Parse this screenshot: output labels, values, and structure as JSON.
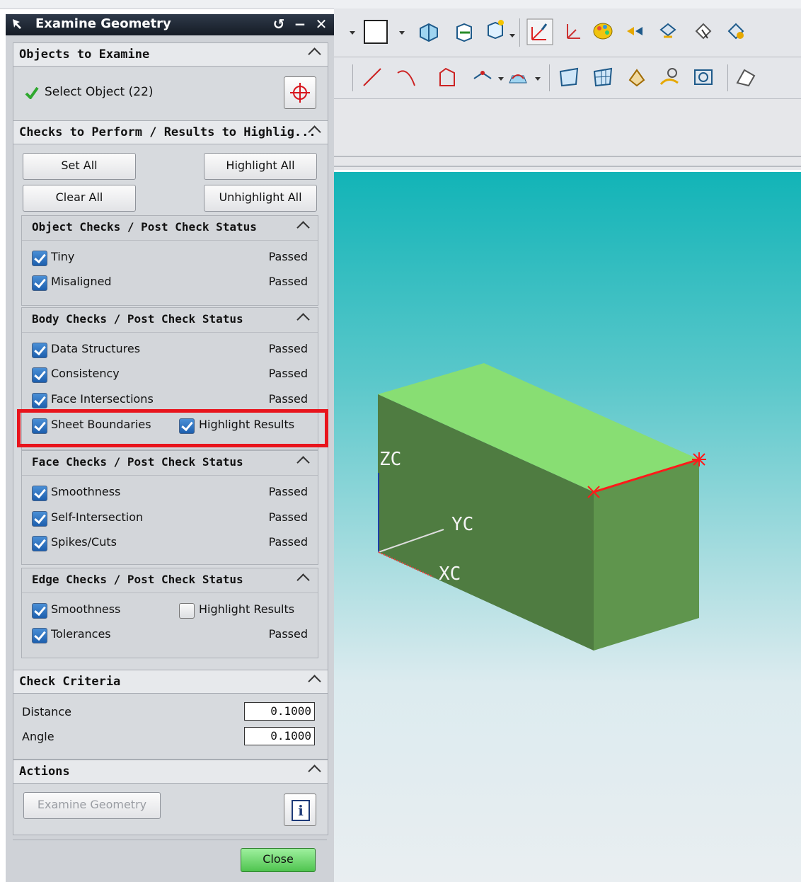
{
  "dialog": {
    "title": "Examine Geometry",
    "title_buttons": [
      "reset-icon",
      "minimize-icon",
      "close-icon"
    ]
  },
  "objects_to_examine": {
    "header": "Objects to Examine",
    "select_label": "Select Object (22)"
  },
  "checks": {
    "header": "Checks to Perform / Results to Highlig...",
    "buttons": {
      "set_all": "Set All",
      "highlight_all": "Highlight All",
      "clear_all": "Clear All",
      "unhighlight_all": "Unhighlight All"
    },
    "object_checks": {
      "header": "Object Checks / Post Check Status",
      "rows": [
        {
          "label": "Tiny",
          "checked": true,
          "status": "Passed"
        },
        {
          "label": "Misaligned",
          "checked": true,
          "status": "Passed"
        }
      ]
    },
    "body_checks": {
      "header": "Body Checks / Post Check Status",
      "rows": [
        {
          "label": "Data Structures",
          "checked": true,
          "status": "Passed"
        },
        {
          "label": "Consistency",
          "checked": true,
          "status": "Passed"
        },
        {
          "label": "Face Intersections",
          "checked": true,
          "status": "Passed"
        },
        {
          "label": "Sheet Boundaries",
          "checked": true,
          "highlight_label": "Highlight Results",
          "highlight_checked": true
        }
      ]
    },
    "face_checks": {
      "header": "Face Checks / Post Check Status",
      "rows": [
        {
          "label": "Smoothness",
          "checked": true,
          "status": "Passed"
        },
        {
          "label": "Self-Intersection",
          "checked": true,
          "status": "Passed"
        },
        {
          "label": "Spikes/Cuts",
          "checked": true,
          "status": "Passed"
        }
      ]
    },
    "edge_checks": {
      "header": "Edge Checks / Post Check Status",
      "rows": [
        {
          "label": "Smoothness",
          "checked": true,
          "highlight_label": "Highlight Results",
          "highlight_checked": false
        },
        {
          "label": "Tolerances",
          "checked": true,
          "status": "Passed"
        }
      ]
    }
  },
  "check_criteria": {
    "header": "Check Criteria",
    "distance_label": "Distance",
    "distance_value": "0.1000",
    "angle_label": "Angle",
    "angle_value": "0.1000"
  },
  "actions": {
    "header": "Actions",
    "examine_button": "Examine Geometry",
    "info_icon": "i"
  },
  "close_button": "Close",
  "viewport": {
    "axis_labels": {
      "zc": "ZC",
      "yc": "YC",
      "xc": "XC"
    },
    "colors": {
      "top_face": "#88de73",
      "front_face": "#4f7c41",
      "side_face": "#5f954d",
      "highlight_edge": "#ff1a1a",
      "annotation_box": "#e8141c",
      "close_button": "#6fd66f"
    }
  }
}
